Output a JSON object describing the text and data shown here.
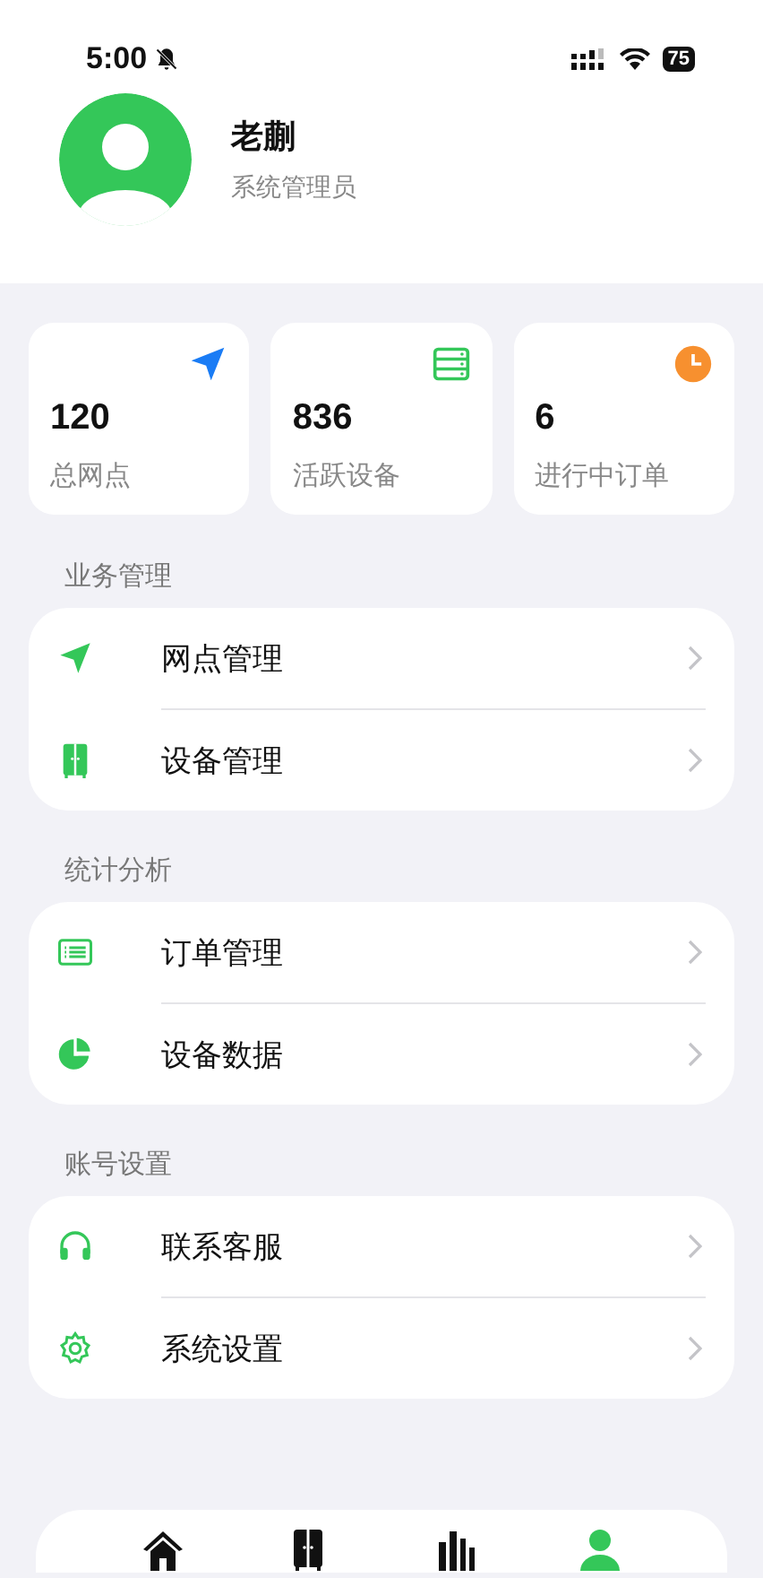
{
  "status_bar": {
    "time": "5:00",
    "muted": true,
    "battery": "75"
  },
  "profile": {
    "name": "老蒯",
    "role": "系统管理员"
  },
  "stats": [
    {
      "value": "120",
      "label": "总网点",
      "kind": "navigation"
    },
    {
      "value": "836",
      "label": "活跃设备",
      "kind": "server"
    },
    {
      "value": "6",
      "label": "进行中订单",
      "kind": "clock"
    }
  ],
  "sections": [
    {
      "title": "业务管理",
      "items": [
        {
          "label": "网点管理",
          "kind": "navigation"
        },
        {
          "label": "设备管理",
          "kind": "cabinet"
        }
      ]
    },
    {
      "title": "统计分析",
      "items": [
        {
          "label": "订单管理",
          "kind": "list"
        },
        {
          "label": "设备数据",
          "kind": "pie"
        }
      ]
    },
    {
      "title": "账号设置",
      "items": [
        {
          "label": "联系客服",
          "kind": "headphones"
        },
        {
          "label": "系统设置",
          "kind": "gear"
        }
      ]
    }
  ],
  "tab_bar": [
    {
      "kind": "home",
      "selected": false
    },
    {
      "kind": "cabinet",
      "selected": false
    },
    {
      "kind": "chart",
      "selected": false
    },
    {
      "kind": "person",
      "selected": true
    }
  ]
}
